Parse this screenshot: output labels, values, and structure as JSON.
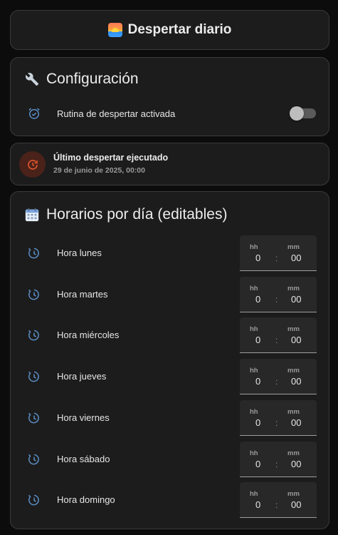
{
  "header": {
    "title": "Despertar diario",
    "icon": "sunrise-icon"
  },
  "config": {
    "title": "Configuración",
    "icon": "wrench-icon",
    "routine_label": "Rutina de despertar activada",
    "routine_icon": "alarm-check-icon",
    "routine_enabled": false
  },
  "last_wakeup": {
    "title": "Último despertar ejecutado",
    "datetime": "29 de junio de 2025, 00:00",
    "icon": "history-icon",
    "accent": "#e0562f"
  },
  "schedule": {
    "title": "Horarios por día (editables)",
    "icon": "calendar-icon",
    "hh_label": "hh",
    "mm_label": "mm",
    "separator": ":",
    "days": [
      {
        "label": "Hora lunes",
        "hh": "0",
        "mm": "00"
      },
      {
        "label": "Hora martes",
        "hh": "0",
        "mm": "00"
      },
      {
        "label": "Hora miércoles",
        "hh": "0",
        "mm": "00"
      },
      {
        "label": "Hora jueves",
        "hh": "0",
        "mm": "00"
      },
      {
        "label": "Hora viernes",
        "hh": "0",
        "mm": "00"
      },
      {
        "label": "Hora sábado",
        "hh": "0",
        "mm": "00"
      },
      {
        "label": "Hora domingo",
        "hh": "0",
        "mm": "00"
      }
    ]
  },
  "colors": {
    "icon_blue": "#5b8fc7",
    "card_bg": "#1c1c1c",
    "page_bg": "#0c0c0c"
  }
}
